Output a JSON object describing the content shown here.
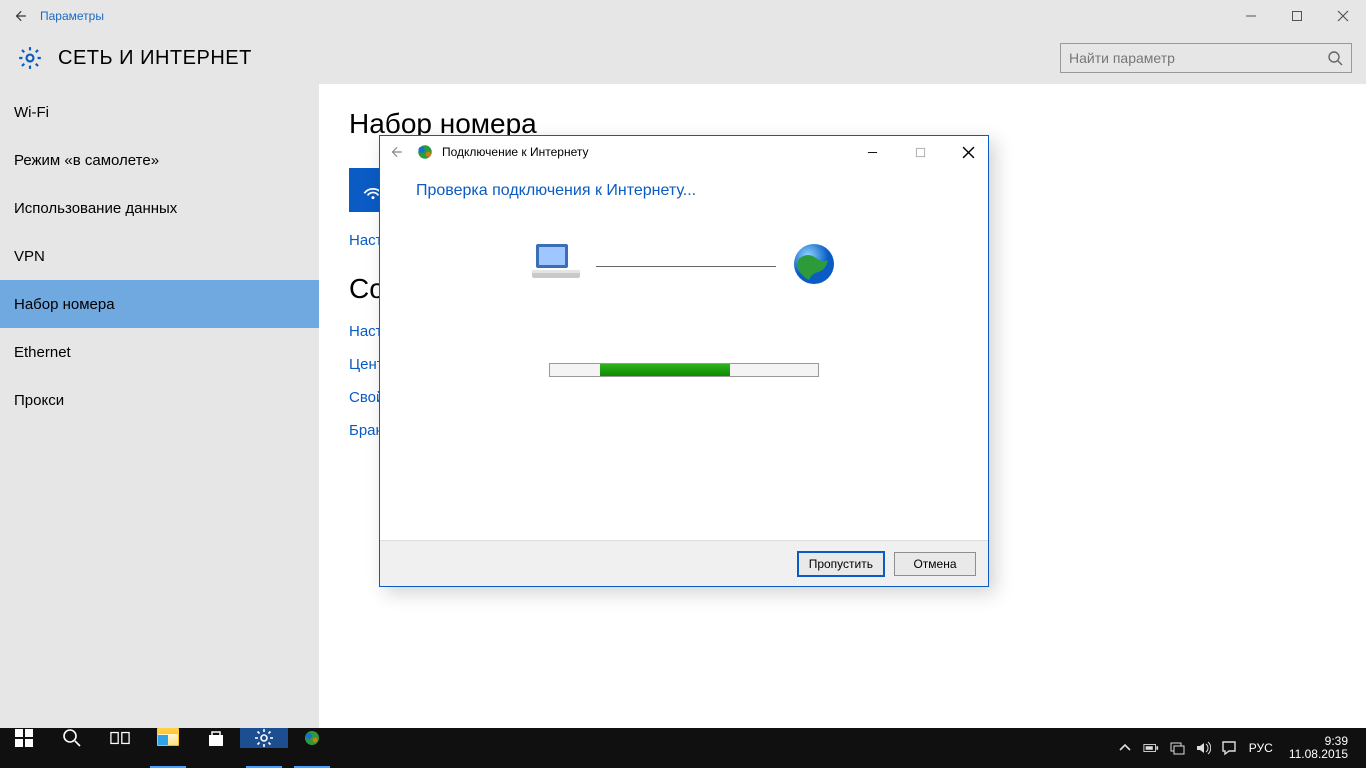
{
  "window": {
    "app_title": "Параметры",
    "section_title": "СЕТЬ И ИНТЕРНЕТ",
    "search_placeholder": "Найти параметр"
  },
  "sidebar": {
    "items": [
      {
        "label": "Wi-Fi"
      },
      {
        "label": "Режим «в самолете»"
      },
      {
        "label": "Использование данных"
      },
      {
        "label": "VPN"
      },
      {
        "label": "Набор номера"
      },
      {
        "label": "Ethernet"
      },
      {
        "label": "Прокси"
      }
    ],
    "selected_index": 4
  },
  "content": {
    "heading": "Набор номера",
    "connection_tile_label": "",
    "setup_link": "Настр",
    "related_heading": "Со",
    "links": [
      "Наст",
      "Цент",
      "Свой",
      "Бран"
    ]
  },
  "dialog": {
    "caption": "Подключение к Интернету",
    "heading": "Проверка подключения к Интернету...",
    "skip_label": "Пропустить",
    "cancel_label": "Отмена"
  },
  "taskbar": {
    "lang": "РУС",
    "time": "9:39",
    "date": "11.08.2015"
  },
  "icons": {
    "back": "back-arrow-icon",
    "min": "minimize-icon",
    "max": "maximize-icon",
    "close": "close-icon",
    "gear": "gear-icon",
    "search": "search-icon",
    "dial": "dial-icon",
    "globe": "globe-icon",
    "pc": "computer-icon"
  }
}
